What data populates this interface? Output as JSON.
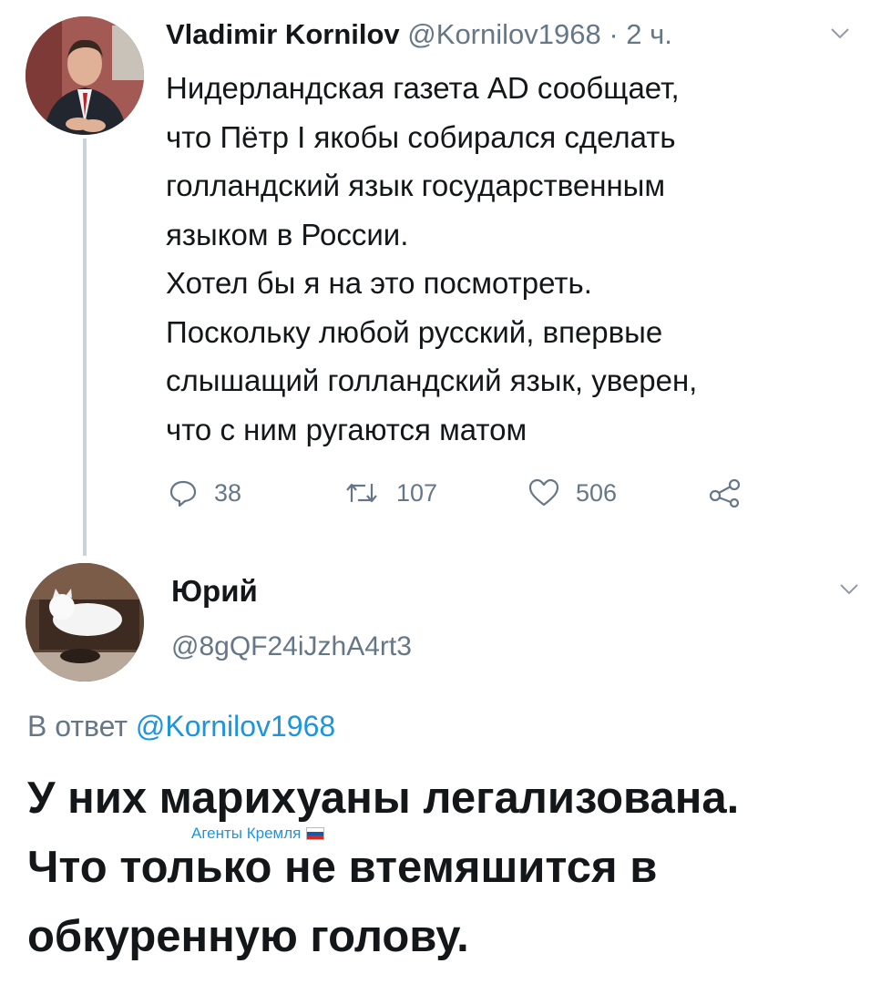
{
  "tweet1": {
    "author_name": "Vladimir Kornilov",
    "author_handle": "@Kornilov1968",
    "time": "· 2 ч.",
    "body_lines": [
      "Нидерландская газета AD сообщает,",
      "что Пётр I якобы собирался сделать",
      "голландский язык государственным",
      "языком в России.",
      "Хотел бы я на это посмотреть.",
      "Поскольку любой русский, впервые",
      "слышащий голландский язык, уверен,",
      "что с ним ругаются матом"
    ],
    "replies": "38",
    "retweets": "107",
    "likes": "506"
  },
  "tweet2": {
    "author_name": "Юрий",
    "author_handle": "@8gQF24iJzhA4rt3",
    "reply_prefix": "В ответ",
    "reply_mention": "@Kornilov1968",
    "body_lines": [
      "У них марихуаны легализована.",
      "Что только не втемяшится в",
      "обкуренную голову."
    ]
  },
  "watermark": "Агенты Кремля",
  "colors": {
    "text": "#14171a",
    "muted": "#657786",
    "link": "#1b95e0",
    "thread_line": "#c9d3db"
  },
  "icons": [
    "reply-icon",
    "retweet-icon",
    "like-icon",
    "share-icon",
    "chevron-down-icon"
  ]
}
